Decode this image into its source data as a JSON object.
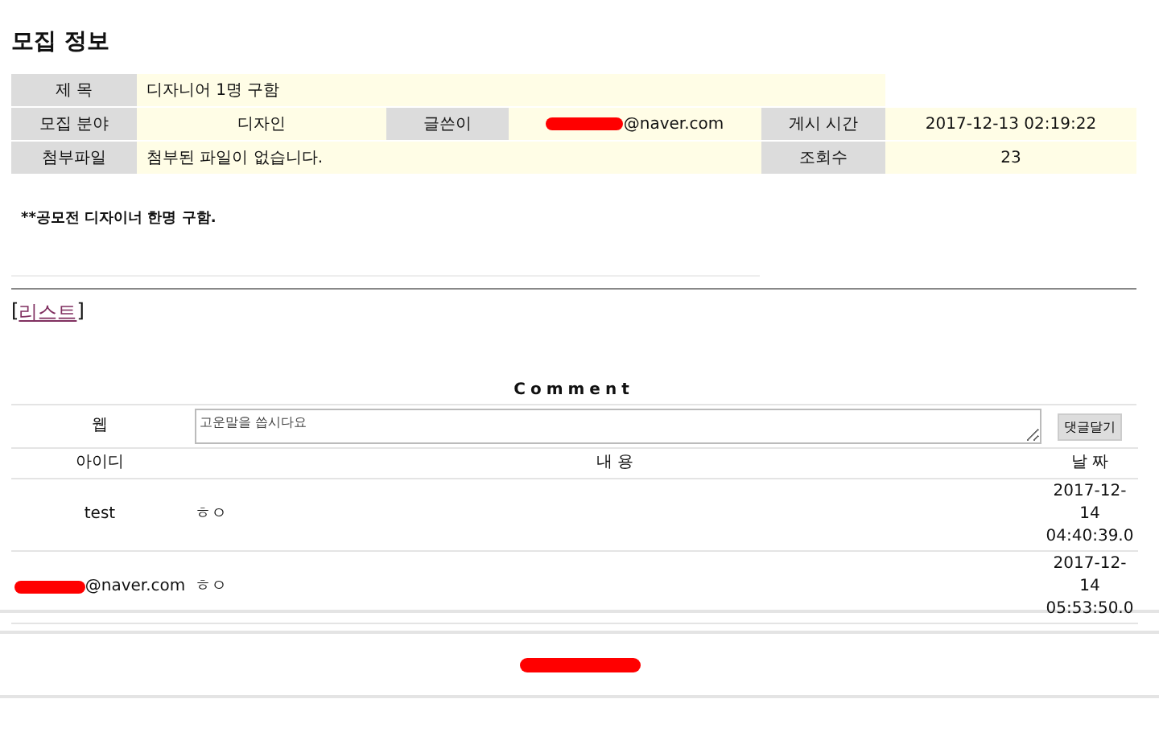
{
  "title": "모집 정보",
  "info": {
    "rows": [
      [
        {
          "kind": "label",
          "text": "제 목"
        },
        {
          "kind": "value",
          "text": "디자니어 1명 구함"
        },
        {
          "kind": "merged"
        },
        {
          "kind": "merged"
        },
        {
          "kind": "merged"
        }
      ],
      [
        {
          "kind": "label",
          "text": "모집 분야"
        },
        {
          "kind": "value",
          "text": "디자인"
        },
        {
          "kind": "label",
          "text": "글쓴이"
        },
        {
          "kind": "email",
          "text": "@naver.com"
        },
        {
          "kind": "label",
          "text": "게시 시간"
        },
        {
          "kind": "value",
          "text": "2017-12-13 02:19:22"
        }
      ],
      [
        {
          "kind": "label",
          "text": "첨부파일"
        },
        {
          "kind": "value",
          "text": "첨부된 파일이 없습니다."
        },
        {
          "kind": "merged"
        },
        {
          "kind": "merged"
        },
        {
          "kind": "label",
          "text": "조회수"
        },
        {
          "kind": "value",
          "text": "23"
        }
      ]
    ]
  },
  "body": "**공모전 디자이너 한명 구함.",
  "list_link": {
    "open": "[",
    "label": "리스트 ",
    "close": "]"
  },
  "comment": {
    "title": "Comment",
    "writer": "웹",
    "placeholder": "고운말을 씁시다요",
    "button": "댓글달기",
    "columns": [
      "아이디",
      "내 용",
      "날 짜"
    ],
    "rows": [
      {
        "id": "test",
        "redacted": false,
        "content": "ㅎㅇ",
        "date": [
          "2017-12-",
          "14",
          "04:40:39.0"
        ]
      },
      {
        "id": "@naver.com",
        "redacted": true,
        "content": "ㅎㅇ",
        "date": [
          "2017-12-",
          "14",
          "05:53:50.0"
        ]
      }
    ]
  },
  "footer": {
    "redacted": true
  }
}
